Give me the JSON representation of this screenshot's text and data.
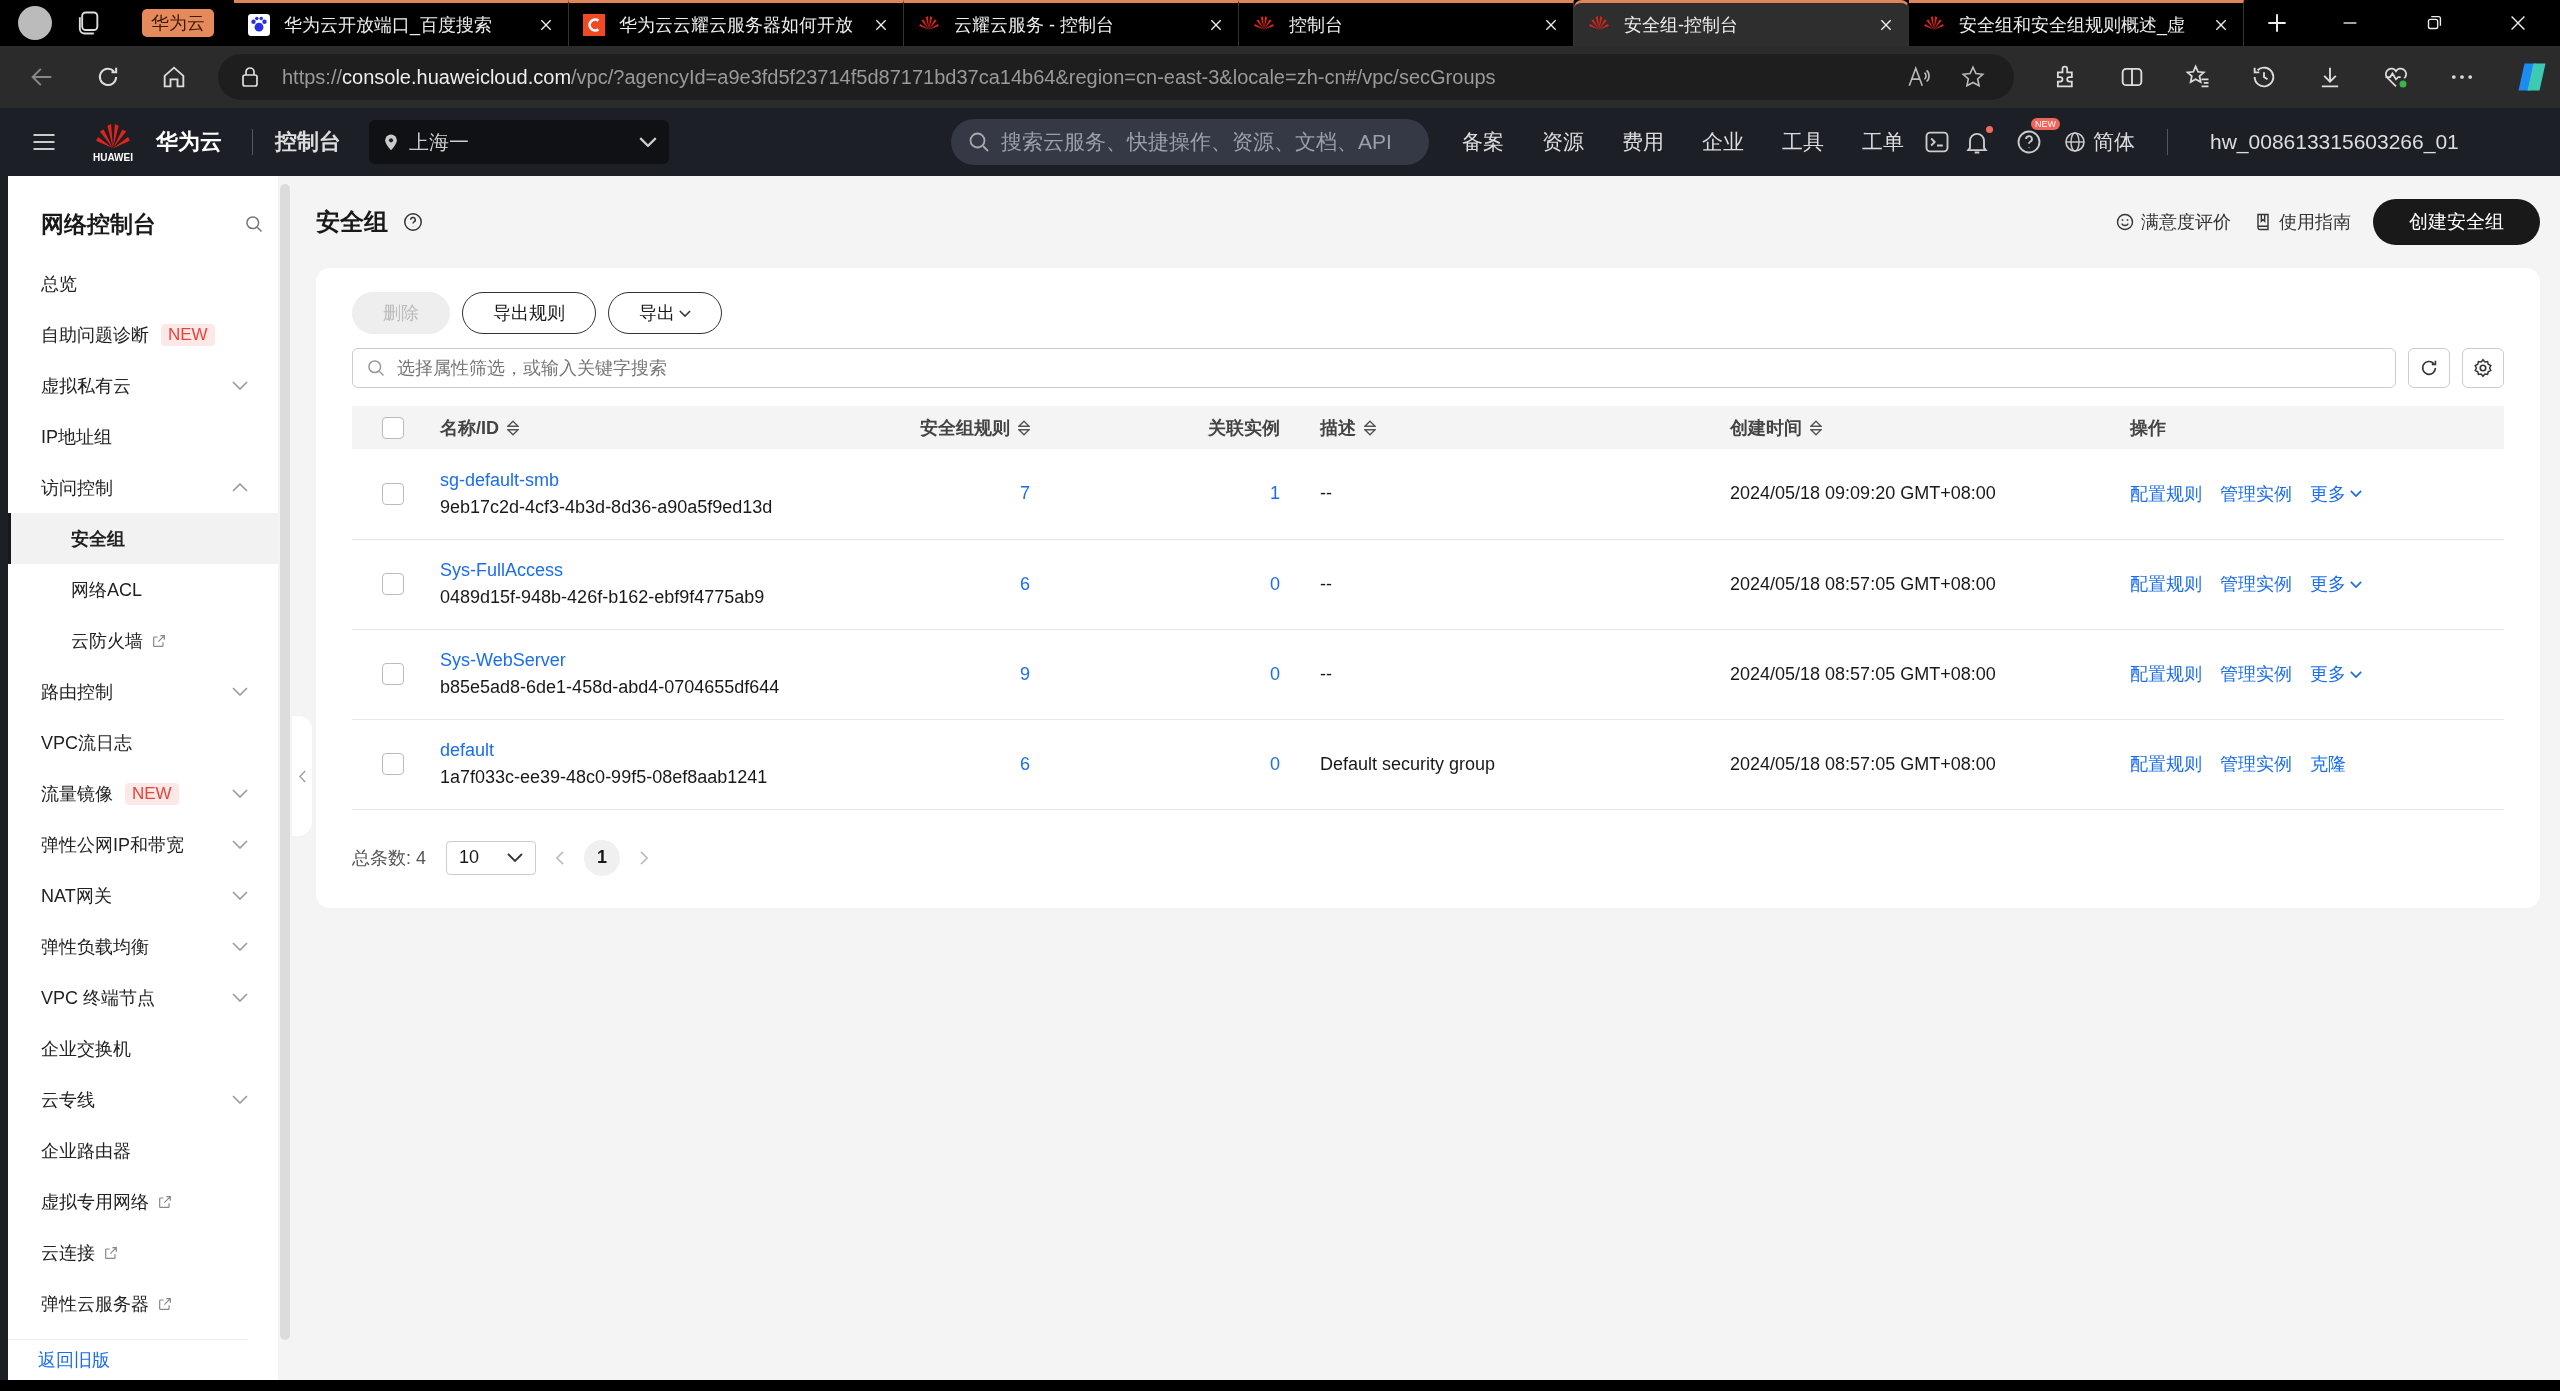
{
  "browser": {
    "group_label": "华为云",
    "tabs": [
      {
        "title": "华为云开放端口_百度搜索",
        "kind": "paw",
        "selected": false
      },
      {
        "title": "华为云云耀云服务器如何开放",
        "kind": "c",
        "selected": false
      },
      {
        "title": "云耀云服务 - 控制台",
        "kind": "huawei",
        "selected": false
      },
      {
        "title": "控制台",
        "kind": "huawei",
        "selected": false
      },
      {
        "title": "安全组-控制台",
        "kind": "huawei",
        "selected": true
      },
      {
        "title": "安全组和安全组规则概述_虚",
        "kind": "huawei",
        "selected": false
      }
    ],
    "url": {
      "scheme": "https://",
      "host": "console.huaweicloud.com",
      "path": "/vpc/?agencyId=a9e3fd5f23714f5d87171bd37ca14b64&region=cn-east-3&locale=zh-cn#/vpc/secGroups"
    }
  },
  "header": {
    "logo_text": "HUAWEI",
    "brand": "华为云",
    "console": "控制台",
    "region": "上海一",
    "search_placeholder": "搜索云服务、快捷操作、资源、文档、API",
    "nav": [
      "备案",
      "资源",
      "费用",
      "企业",
      "工具",
      "工单"
    ],
    "help_badge": "NEW",
    "language": "简体",
    "user": "hw_008613315603266_01"
  },
  "sidebar": {
    "title": "网络控制台",
    "items": [
      {
        "label": "总览",
        "kind": "item"
      },
      {
        "label": "自助问题诊断",
        "kind": "item",
        "badge": "NEW"
      },
      {
        "label": "虚拟私有云",
        "kind": "group",
        "expanded": false
      },
      {
        "label": "IP地址组",
        "kind": "item"
      },
      {
        "label": "访问控制",
        "kind": "group",
        "expanded": true,
        "children": [
          {
            "label": "安全组",
            "selected": true
          },
          {
            "label": "网络ACL",
            "selected": false
          },
          {
            "label": "云防火墙",
            "selected": false,
            "external": true
          }
        ]
      },
      {
        "label": "路由控制",
        "kind": "group",
        "expanded": false
      },
      {
        "label": "VPC流日志",
        "kind": "item"
      },
      {
        "label": "流量镜像",
        "kind": "group",
        "expanded": false,
        "badge": "NEW"
      },
      {
        "label": "弹性公网IP和带宽",
        "kind": "group",
        "expanded": false
      },
      {
        "label": "NAT网关",
        "kind": "group",
        "expanded": false
      },
      {
        "label": "弹性负载均衡",
        "kind": "group",
        "expanded": false
      },
      {
        "label": "VPC 终端节点",
        "kind": "group",
        "expanded": false
      },
      {
        "label": "企业交换机",
        "kind": "item"
      },
      {
        "label": "云专线",
        "kind": "group",
        "expanded": false
      },
      {
        "label": "企业路由器",
        "kind": "item"
      },
      {
        "label": "虚拟专用网络",
        "kind": "item",
        "external": true
      },
      {
        "label": "云连接",
        "kind": "item",
        "external": true
      },
      {
        "label": "弹性云服务器",
        "kind": "item",
        "external": true
      }
    ],
    "footer_link": "返回旧版"
  },
  "page": {
    "title": "安全组",
    "links": [
      {
        "label": "满意度评价",
        "kind": "smile"
      },
      {
        "label": "使用指南",
        "kind": "book"
      }
    ],
    "primary_button": "创建安全组",
    "toolbar": [
      {
        "label": "删除",
        "disabled": true,
        "dropdown": false
      },
      {
        "label": "导出规则",
        "disabled": false,
        "dropdown": false
      },
      {
        "label": "导出",
        "disabled": false,
        "dropdown": true
      }
    ],
    "search_placeholder": "选择属性筛选，或输入关键字搜索",
    "table": {
      "select_all_checked": false,
      "columns": [
        {
          "label": "名称/ID",
          "sortable": true
        },
        {
          "label": "安全组规则",
          "sortable": true
        },
        {
          "label": "关联实例",
          "sortable": false
        },
        {
          "label": "描述",
          "sortable": true
        },
        {
          "label": "创建时间",
          "sortable": true
        },
        {
          "label": "操作",
          "sortable": false
        }
      ],
      "rows": [
        {
          "name": "sg-default-smb",
          "id": "9eb17c2d-4cf3-4b3d-8d36-a90a5f9ed13d",
          "checked": false,
          "rules": "7",
          "instances": "1",
          "description": "--",
          "created": "2024/05/18 09:09:20 GMT+08:00",
          "actions": [
            "配置规则",
            "管理实例"
          ],
          "more": "更多"
        },
        {
          "name": "Sys-FullAccess",
          "id": "0489d15f-948b-426f-b162-ebf9f4775ab9",
          "checked": false,
          "rules": "6",
          "instances": "0",
          "description": "--",
          "created": "2024/05/18 08:57:05 GMT+08:00",
          "actions": [
            "配置规则",
            "管理实例"
          ],
          "more": "更多"
        },
        {
          "name": "Sys-WebServer",
          "id": "b85e5ad8-6de1-458d-abd4-0704655df644",
          "checked": false,
          "rules": "9",
          "instances": "0",
          "description": "--",
          "created": "2024/05/18 08:57:05 GMT+08:00",
          "actions": [
            "配置规则",
            "管理实例"
          ],
          "more": "更多"
        },
        {
          "name": "default",
          "id": "1a7f033c-ee39-48c0-99f5-08ef8aab1241",
          "checked": false,
          "rules": "6",
          "instances": "0",
          "description": "Default security group",
          "created": "2024/05/18 08:57:05 GMT+08:00",
          "actions": [
            "配置规则",
            "管理实例",
            "克隆"
          ]
        }
      ]
    },
    "pagination": {
      "total_label": "总条数:",
      "total": "4",
      "page_size": "10",
      "pages": [
        {
          "label": "1",
          "selected": true
        }
      ]
    }
  }
}
